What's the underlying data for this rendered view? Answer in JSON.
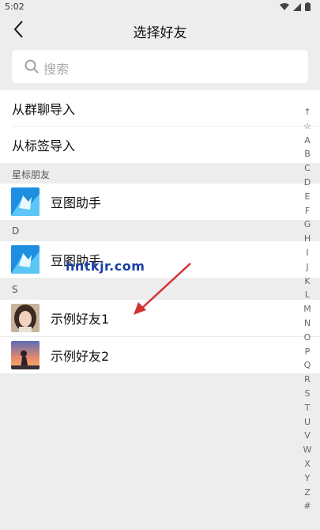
{
  "status_bar": {
    "time": "5:02"
  },
  "header": {
    "title": "选择好友"
  },
  "search": {
    "placeholder": "搜索"
  },
  "import_options": [
    "从群聊导入",
    "从标签导入"
  ],
  "sections": [
    {
      "header": "星标朋友",
      "contacts": [
        {
          "name": "豆图助手",
          "avatar": "app-icon"
        }
      ]
    },
    {
      "header": "D",
      "contacts": [
        {
          "name": "豆图助手",
          "avatar": "app-icon"
        }
      ]
    },
    {
      "header": "S",
      "contacts": [
        {
          "name": "示例好友1",
          "avatar": "photo-girl"
        },
        {
          "name": "示例好友2",
          "avatar": "photo-sunset"
        }
      ]
    }
  ],
  "index_bar": [
    "↑",
    "☆",
    "A",
    "B",
    "C",
    "D",
    "E",
    "F",
    "G",
    "H",
    "I",
    "J",
    "K",
    "L",
    "M",
    "N",
    "O",
    "P",
    "Q",
    "R",
    "S",
    "T",
    "U",
    "V",
    "W",
    "X",
    "Y",
    "Z",
    "#"
  ],
  "watermark": "hntkjr.com",
  "colors": {
    "background": "#ededed",
    "arrow": "#d23232",
    "watermark": "#1b3fa8"
  }
}
